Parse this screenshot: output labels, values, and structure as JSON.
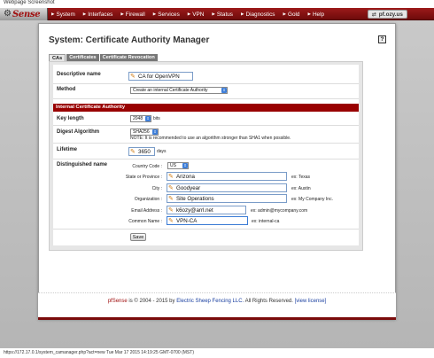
{
  "screenshot_label": "Webpage Screenshot",
  "logo": {
    "text": "Sense"
  },
  "nav": [
    {
      "label": "System"
    },
    {
      "label": "Interfaces"
    },
    {
      "label": "Firewall"
    },
    {
      "label": "Services"
    },
    {
      "label": "VPN"
    },
    {
      "label": "Status"
    },
    {
      "label": "Diagnostics"
    },
    {
      "label": "Gold"
    },
    {
      "label": "Help"
    }
  ],
  "host": "pf.ozy.us",
  "page_title": "System: Certificate Authority Manager",
  "help_icon_label": "?",
  "tabs": [
    {
      "label": "CAs",
      "active": true
    },
    {
      "label": "Certificates",
      "active": false
    },
    {
      "label": "Certificate Revocation",
      "active": false
    }
  ],
  "form": {
    "descriptive_name_label": "Descriptive name",
    "descriptive_name_value": "CA for OpenVPN",
    "method_label": "Method",
    "method_value": "Create an internal Certificate Authority",
    "section_title": "Internal Certificate Authority",
    "key_length_label": "Key length",
    "key_length_value": "2048",
    "key_length_unit": "bits",
    "digest_label": "Digest Algorithm",
    "digest_value": "SHA256",
    "digest_note": "NOTE: It is recommended to use an algorithm stronger than SHA1 when possible.",
    "lifetime_label": "Lifetime",
    "lifetime_value": "3650",
    "lifetime_unit": "days",
    "dn_label": "Distinguished name",
    "dn": {
      "country_label": "Country Code :",
      "country_value": "US",
      "state_label": "State or Province :",
      "state_value": "Arizona",
      "state_example": "ex:  Texas",
      "city_label": "City :",
      "city_value": "Goodyear",
      "city_example": "ex:  Austin",
      "org_label": "Organization :",
      "org_value": "Site Operations",
      "org_example": "ex:  My Company Inc.",
      "email_label": "Email Address :",
      "email_value": "k6ozy@arrl.net",
      "email_example": "ex:  admin@mycompany.com",
      "cn_label": "Common Name :",
      "cn_value": "VPN-CA",
      "cn_example": "ex:  internal-ca"
    },
    "save_label": "Save"
  },
  "footer": {
    "brand": "pfSense",
    "middle": "is © 2004 - 2015 by",
    "company": "Electric Sheep Fencing LLC.",
    "rights": "All Rights Reserved.",
    "license": "[view license]"
  },
  "status_bar": "https://172.17.0.1/system_camanager.php?act=new Tue Mar 17 2015 14:19:25 GMT-0700 (MST)"
}
